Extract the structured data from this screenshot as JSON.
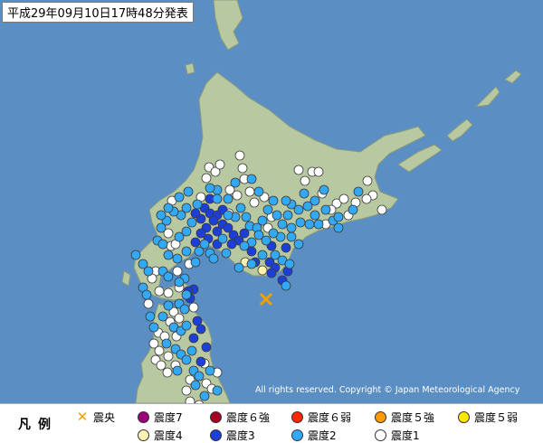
{
  "title": "平成29年09月10日17時48分発表",
  "copyright": "All rights reserved. Copyright © Japan Meteorological Agency",
  "legend": {
    "title": "凡例",
    "items": [
      {
        "label": "震央",
        "color": "#f0a000",
        "kind": "epicenter"
      },
      {
        "label": "震度7",
        "color": "#9a0079"
      },
      {
        "label": "震度６強",
        "color": "#a50021"
      },
      {
        "label": "震度６弱",
        "color": "#ff2800"
      },
      {
        "label": "震度５強",
        "color": "#ff9900"
      },
      {
        "label": "震度５弱",
        "color": "#ffe600"
      },
      {
        "label": "震度4",
        "color": "#fff2b2"
      },
      {
        "label": "震度3",
        "color": "#1c3fd9"
      },
      {
        "label": "震度2",
        "color": "#33a8f5"
      },
      {
        "label": "震度1",
        "color": "#ffffff"
      }
    ]
  },
  "colors": {
    "sea": "#5b8fc4",
    "land": "#b8c9a2",
    "land_border": "#8a9a7a",
    "epicenter": "#f0a000"
  },
  "icons": {
    "epicenter": "cross-mark-icon"
  },
  "observations": {
    "intensity_4": 2,
    "intensity_3": 37,
    "intensity_2": 112,
    "intensity_1": 65
  }
}
